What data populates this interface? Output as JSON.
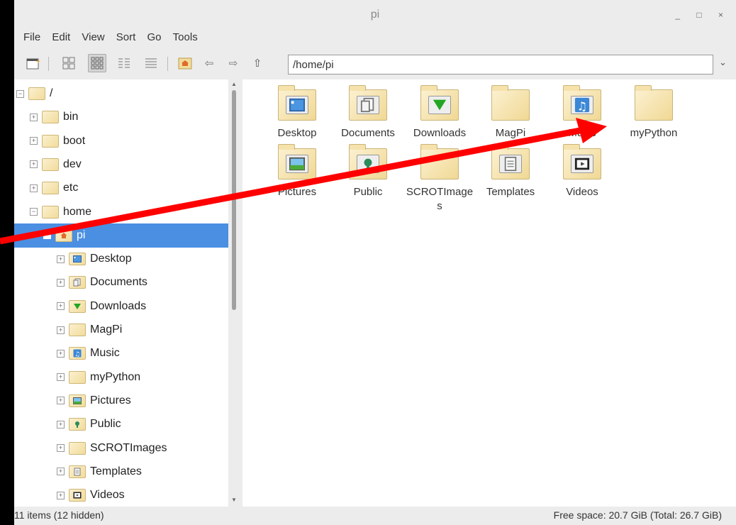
{
  "window": {
    "title": "pi",
    "controls": "_ □ ×"
  },
  "menu": [
    "File",
    "Edit",
    "View",
    "Sort",
    "Go",
    "Tools"
  ],
  "toolbar": {
    "path": "/home/pi"
  },
  "tree": [
    {
      "label": "/",
      "expander": "−",
      "icon": "folder"
    },
    {
      "label": "bin",
      "expander": "+",
      "icon": "folder"
    },
    {
      "label": "boot",
      "expander": "+",
      "icon": "folder"
    },
    {
      "label": "dev",
      "expander": "+",
      "icon": "folder"
    },
    {
      "label": "etc",
      "expander": "+",
      "icon": "folder"
    },
    {
      "label": "home",
      "expander": "−",
      "icon": "folder"
    },
    {
      "label": "pi",
      "expander": "−",
      "icon": "home",
      "selected": true
    },
    {
      "label": "Desktop",
      "expander": "+",
      "icon": "desktop"
    },
    {
      "label": "Documents",
      "expander": "+",
      "icon": "documents"
    },
    {
      "label": "Downloads",
      "expander": "+",
      "icon": "downloads"
    },
    {
      "label": "MagPi",
      "expander": "+",
      "icon": "folder"
    },
    {
      "label": "Music",
      "expander": "+",
      "icon": "music"
    },
    {
      "label": "myPython",
      "expander": "+",
      "icon": "folder"
    },
    {
      "label": "Pictures",
      "expander": "+",
      "icon": "pictures"
    },
    {
      "label": "Public",
      "expander": "+",
      "icon": "public"
    },
    {
      "label": "SCROTImages",
      "expander": "+",
      "icon": "folder"
    },
    {
      "label": "Templates",
      "expander": "+",
      "icon": "templates"
    },
    {
      "label": "Videos",
      "expander": "+",
      "icon": "videos"
    }
  ],
  "files": [
    {
      "label": "Desktop",
      "icon": "desktop"
    },
    {
      "label": "Documents",
      "icon": "documents"
    },
    {
      "label": "Downloads",
      "icon": "downloads"
    },
    {
      "label": "MagPi",
      "icon": "folder"
    },
    {
      "label": "Music",
      "icon": "music"
    },
    {
      "label": "myPython",
      "icon": "folder"
    },
    {
      "label": "Pictures",
      "icon": "pictures"
    },
    {
      "label": "Public",
      "icon": "public"
    },
    {
      "label": "SCROTImages",
      "icon": "folder"
    },
    {
      "label": "Templates",
      "icon": "templates"
    },
    {
      "label": "Videos",
      "icon": "videos"
    }
  ],
  "status": {
    "items": "11 items (12 hidden)",
    "space": "Free space: 20.7 GiB (Total: 26.7 GiB)"
  },
  "colors": {
    "selection": "#4a8fe2",
    "arrow": "#ff0000",
    "folder": "#f2dc9c"
  }
}
